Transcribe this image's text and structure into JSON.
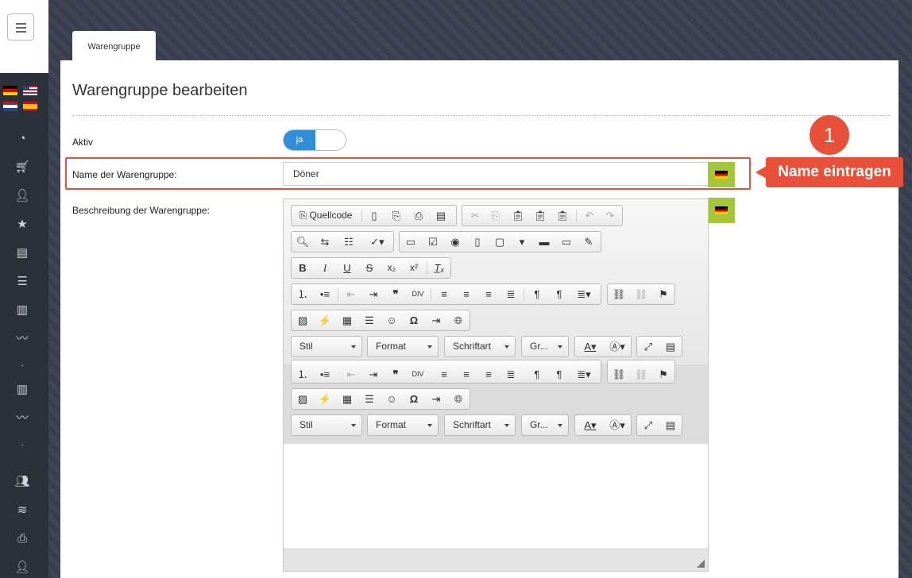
{
  "tab": {
    "label": "Warengruppe"
  },
  "page": {
    "title": "Warengruppe bearbeiten"
  },
  "form": {
    "active_label": "Aktiv",
    "active_value": "ja",
    "name_label": "Name der Warengruppe:",
    "name_value": "Döner",
    "description_label": "Beschreibung der Warengruppe:"
  },
  "annotation": {
    "number": "1",
    "text": "Name eintragen"
  },
  "editor": {
    "source_label": "Quellcode",
    "combos": [
      "Stil",
      "Format",
      "Schriftart",
      "Gr..."
    ]
  },
  "icons": {
    "bold": "B",
    "italic": "I",
    "underline": "U",
    "strike": "S",
    "subscript": "x₂",
    "superscript": "x²",
    "remove_format": "T̲ₓ",
    "omega": "Ω",
    "quote": "❞",
    "paragraph": "¶"
  },
  "colors": {
    "accent": "#e8503a",
    "toggle_on": "#2f8fd6",
    "flag_button": "#a4c639",
    "sidebar": "#2b3138"
  }
}
